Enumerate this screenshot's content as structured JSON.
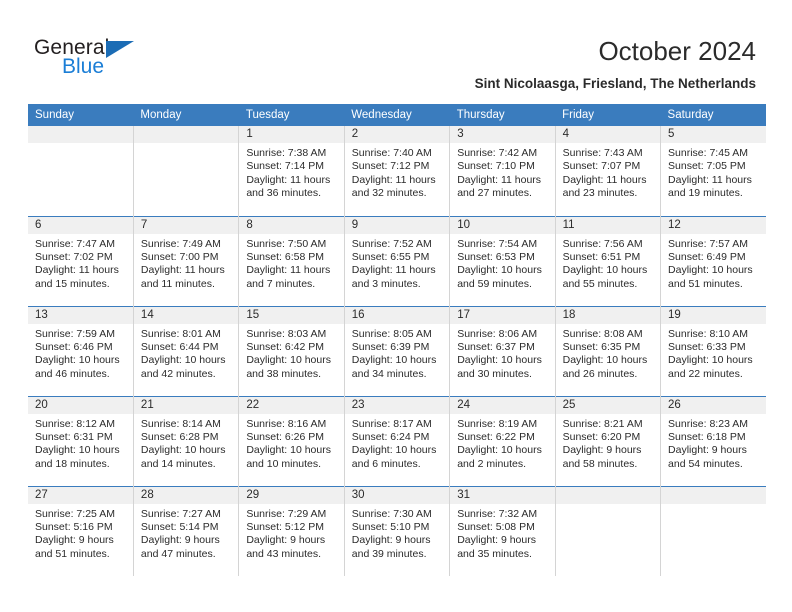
{
  "brand": {
    "name_part1": "General",
    "name_part2": "Blue",
    "triangle_icon": "triangle-icon",
    "accent_color": "#1b7ed6",
    "triangle_color": "#1b6cb5"
  },
  "header": {
    "title": "October 2024",
    "subtitle": "Sint Nicolaasga, Friesland, The Netherlands"
  },
  "theme": {
    "header_blue": "#3a7cbe",
    "daynum_band": "#f0f0f0",
    "grid_line": "#d4d4d4",
    "text": "#2b2b2b"
  },
  "calendar": {
    "weekday_headers": [
      "Sunday",
      "Monday",
      "Tuesday",
      "Wednesday",
      "Thursday",
      "Friday",
      "Saturday"
    ],
    "labels": {
      "sunrise": "Sunrise:",
      "sunset": "Sunset:",
      "daylight": "Daylight:"
    },
    "weeks": [
      [
        {
          "day": "",
          "sunrise": "",
          "sunset": "",
          "daylight_line1": "",
          "daylight_line2": ""
        },
        {
          "day": "",
          "sunrise": "",
          "sunset": "",
          "daylight_line1": "",
          "daylight_line2": ""
        },
        {
          "day": "1",
          "sunrise": "Sunrise: 7:38 AM",
          "sunset": "Sunset: 7:14 PM",
          "daylight_line1": "Daylight: 11 hours",
          "daylight_line2": "and 36 minutes."
        },
        {
          "day": "2",
          "sunrise": "Sunrise: 7:40 AM",
          "sunset": "Sunset: 7:12 PM",
          "daylight_line1": "Daylight: 11 hours",
          "daylight_line2": "and 32 minutes."
        },
        {
          "day": "3",
          "sunrise": "Sunrise: 7:42 AM",
          "sunset": "Sunset: 7:10 PM",
          "daylight_line1": "Daylight: 11 hours",
          "daylight_line2": "and 27 minutes."
        },
        {
          "day": "4",
          "sunrise": "Sunrise: 7:43 AM",
          "sunset": "Sunset: 7:07 PM",
          "daylight_line1": "Daylight: 11 hours",
          "daylight_line2": "and 23 minutes."
        },
        {
          "day": "5",
          "sunrise": "Sunrise: 7:45 AM",
          "sunset": "Sunset: 7:05 PM",
          "daylight_line1": "Daylight: 11 hours",
          "daylight_line2": "and 19 minutes."
        }
      ],
      [
        {
          "day": "6",
          "sunrise": "Sunrise: 7:47 AM",
          "sunset": "Sunset: 7:02 PM",
          "daylight_line1": "Daylight: 11 hours",
          "daylight_line2": "and 15 minutes."
        },
        {
          "day": "7",
          "sunrise": "Sunrise: 7:49 AM",
          "sunset": "Sunset: 7:00 PM",
          "daylight_line1": "Daylight: 11 hours",
          "daylight_line2": "and 11 minutes."
        },
        {
          "day": "8",
          "sunrise": "Sunrise: 7:50 AM",
          "sunset": "Sunset: 6:58 PM",
          "daylight_line1": "Daylight: 11 hours",
          "daylight_line2": "and 7 minutes."
        },
        {
          "day": "9",
          "sunrise": "Sunrise: 7:52 AM",
          "sunset": "Sunset: 6:55 PM",
          "daylight_line1": "Daylight: 11 hours",
          "daylight_line2": "and 3 minutes."
        },
        {
          "day": "10",
          "sunrise": "Sunrise: 7:54 AM",
          "sunset": "Sunset: 6:53 PM",
          "daylight_line1": "Daylight: 10 hours",
          "daylight_line2": "and 59 minutes."
        },
        {
          "day": "11",
          "sunrise": "Sunrise: 7:56 AM",
          "sunset": "Sunset: 6:51 PM",
          "daylight_line1": "Daylight: 10 hours",
          "daylight_line2": "and 55 minutes."
        },
        {
          "day": "12",
          "sunrise": "Sunrise: 7:57 AM",
          "sunset": "Sunset: 6:49 PM",
          "daylight_line1": "Daylight: 10 hours",
          "daylight_line2": "and 51 minutes."
        }
      ],
      [
        {
          "day": "13",
          "sunrise": "Sunrise: 7:59 AM",
          "sunset": "Sunset: 6:46 PM",
          "daylight_line1": "Daylight: 10 hours",
          "daylight_line2": "and 46 minutes."
        },
        {
          "day": "14",
          "sunrise": "Sunrise: 8:01 AM",
          "sunset": "Sunset: 6:44 PM",
          "daylight_line1": "Daylight: 10 hours",
          "daylight_line2": "and 42 minutes."
        },
        {
          "day": "15",
          "sunrise": "Sunrise: 8:03 AM",
          "sunset": "Sunset: 6:42 PM",
          "daylight_line1": "Daylight: 10 hours",
          "daylight_line2": "and 38 minutes."
        },
        {
          "day": "16",
          "sunrise": "Sunrise: 8:05 AM",
          "sunset": "Sunset: 6:39 PM",
          "daylight_line1": "Daylight: 10 hours",
          "daylight_line2": "and 34 minutes."
        },
        {
          "day": "17",
          "sunrise": "Sunrise: 8:06 AM",
          "sunset": "Sunset: 6:37 PM",
          "daylight_line1": "Daylight: 10 hours",
          "daylight_line2": "and 30 minutes."
        },
        {
          "day": "18",
          "sunrise": "Sunrise: 8:08 AM",
          "sunset": "Sunset: 6:35 PM",
          "daylight_line1": "Daylight: 10 hours",
          "daylight_line2": "and 26 minutes."
        },
        {
          "day": "19",
          "sunrise": "Sunrise: 8:10 AM",
          "sunset": "Sunset: 6:33 PM",
          "daylight_line1": "Daylight: 10 hours",
          "daylight_line2": "and 22 minutes."
        }
      ],
      [
        {
          "day": "20",
          "sunrise": "Sunrise: 8:12 AM",
          "sunset": "Sunset: 6:31 PM",
          "daylight_line1": "Daylight: 10 hours",
          "daylight_line2": "and 18 minutes."
        },
        {
          "day": "21",
          "sunrise": "Sunrise: 8:14 AM",
          "sunset": "Sunset: 6:28 PM",
          "daylight_line1": "Daylight: 10 hours",
          "daylight_line2": "and 14 minutes."
        },
        {
          "day": "22",
          "sunrise": "Sunrise: 8:16 AM",
          "sunset": "Sunset: 6:26 PM",
          "daylight_line1": "Daylight: 10 hours",
          "daylight_line2": "and 10 minutes."
        },
        {
          "day": "23",
          "sunrise": "Sunrise: 8:17 AM",
          "sunset": "Sunset: 6:24 PM",
          "daylight_line1": "Daylight: 10 hours",
          "daylight_line2": "and 6 minutes."
        },
        {
          "day": "24",
          "sunrise": "Sunrise: 8:19 AM",
          "sunset": "Sunset: 6:22 PM",
          "daylight_line1": "Daylight: 10 hours",
          "daylight_line2": "and 2 minutes."
        },
        {
          "day": "25",
          "sunrise": "Sunrise: 8:21 AM",
          "sunset": "Sunset: 6:20 PM",
          "daylight_line1": "Daylight: 9 hours",
          "daylight_line2": "and 58 minutes."
        },
        {
          "day": "26",
          "sunrise": "Sunrise: 8:23 AM",
          "sunset": "Sunset: 6:18 PM",
          "daylight_line1": "Daylight: 9 hours",
          "daylight_line2": "and 54 minutes."
        }
      ],
      [
        {
          "day": "27",
          "sunrise": "Sunrise: 7:25 AM",
          "sunset": "Sunset: 5:16 PM",
          "daylight_line1": "Daylight: 9 hours",
          "daylight_line2": "and 51 minutes."
        },
        {
          "day": "28",
          "sunrise": "Sunrise: 7:27 AM",
          "sunset": "Sunset: 5:14 PM",
          "daylight_line1": "Daylight: 9 hours",
          "daylight_line2": "and 47 minutes."
        },
        {
          "day": "29",
          "sunrise": "Sunrise: 7:29 AM",
          "sunset": "Sunset: 5:12 PM",
          "daylight_line1": "Daylight: 9 hours",
          "daylight_line2": "and 43 minutes."
        },
        {
          "day": "30",
          "sunrise": "Sunrise: 7:30 AM",
          "sunset": "Sunset: 5:10 PM",
          "daylight_line1": "Daylight: 9 hours",
          "daylight_line2": "and 39 minutes."
        },
        {
          "day": "31",
          "sunrise": "Sunrise: 7:32 AM",
          "sunset": "Sunset: 5:08 PM",
          "daylight_line1": "Daylight: 9 hours",
          "daylight_line2": "and 35 minutes."
        },
        {
          "day": "",
          "sunrise": "",
          "sunset": "",
          "daylight_line1": "",
          "daylight_line2": ""
        },
        {
          "day": "",
          "sunrise": "",
          "sunset": "",
          "daylight_line1": "",
          "daylight_line2": ""
        }
      ]
    ]
  }
}
